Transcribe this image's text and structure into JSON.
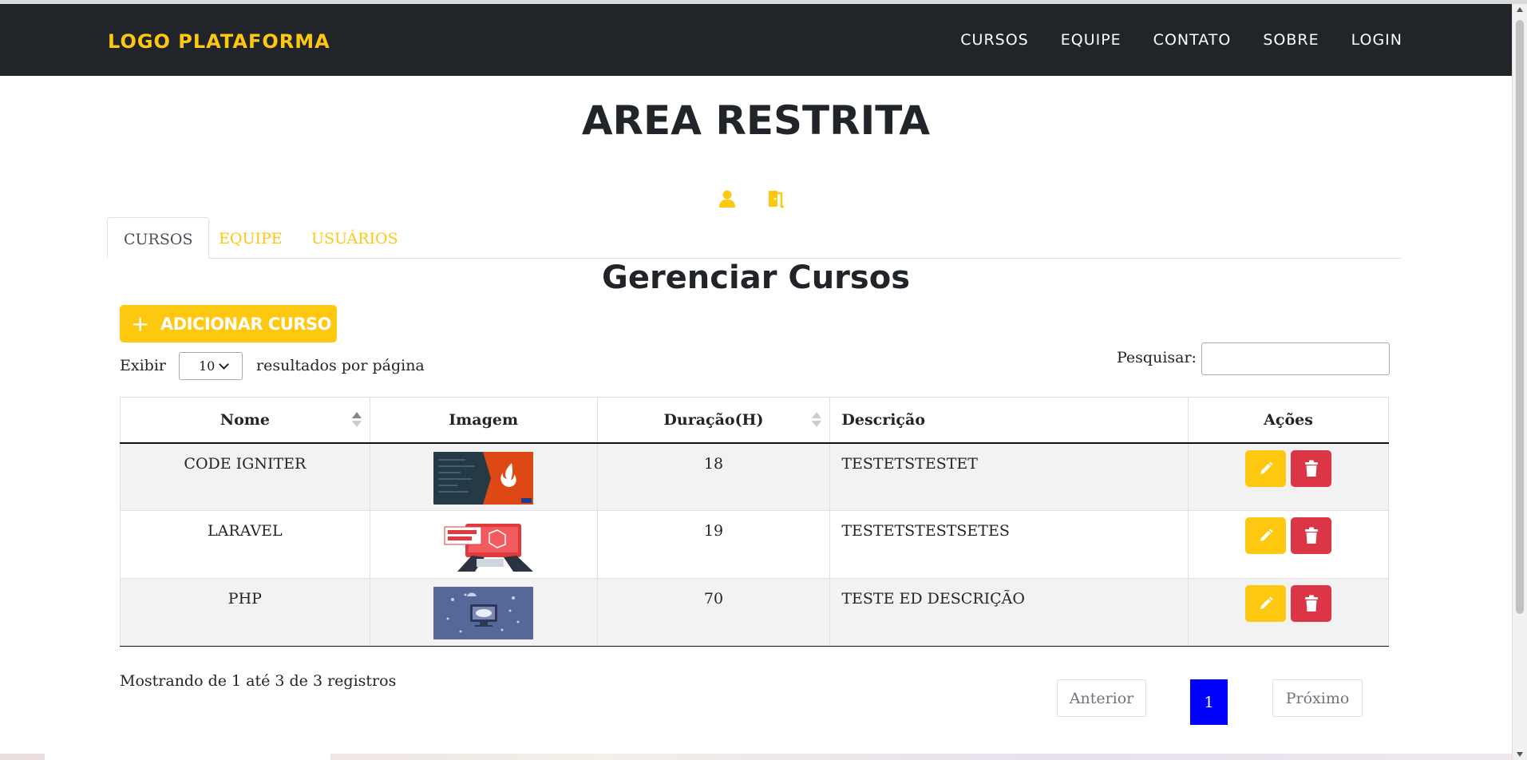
{
  "navbar": {
    "logo": "LOGO PLATAFORMA",
    "links": [
      "CURSOS",
      "EQUIPE",
      "CONTATO",
      "SOBRE",
      "LOGIN"
    ]
  },
  "page": {
    "title": "AREA RESTRITA"
  },
  "user_icons": [
    "user-icon",
    "door-exit-icon"
  ],
  "tabs": [
    {
      "label": "CURSOS",
      "active": true
    },
    {
      "label": "EQUIPE",
      "active": false
    },
    {
      "label": "USUÁRIOS",
      "active": false
    }
  ],
  "section": {
    "title": "Gerenciar Cursos",
    "add_label": "ADICIONAR CURSO"
  },
  "length_control": {
    "prefix": "Exibir",
    "value": "10",
    "suffix": "resultados por página"
  },
  "search": {
    "label": "Pesquisar:",
    "value": ""
  },
  "table": {
    "headers": [
      "Nome",
      "Imagem",
      "Duração(H)",
      "Descrição",
      "Ações"
    ],
    "rows": [
      {
        "nome": "CODE IGNITER",
        "image_icon": "codeigniter-thumbnail",
        "duracao": "18",
        "descricao": "TESTETSTESTET"
      },
      {
        "nome": "LARAVEL",
        "image_icon": "laravel-thumbnail",
        "duracao": "19",
        "descricao": "TESTETSTESTSETES"
      },
      {
        "nome": "PHP",
        "image_icon": "php-thumbnail",
        "duracao": "70",
        "descricao": "TESTE ED DESCRIÇÃO"
      }
    ]
  },
  "info": "Mostrando de 1 até 3 de 3 registros",
  "pagination": {
    "previous": "Anterior",
    "current": "1",
    "next": "Próximo"
  },
  "colors": {
    "accent": "#fec810",
    "navbar": "#212529",
    "danger": "#dc3545",
    "page_active": "#0000ff"
  }
}
